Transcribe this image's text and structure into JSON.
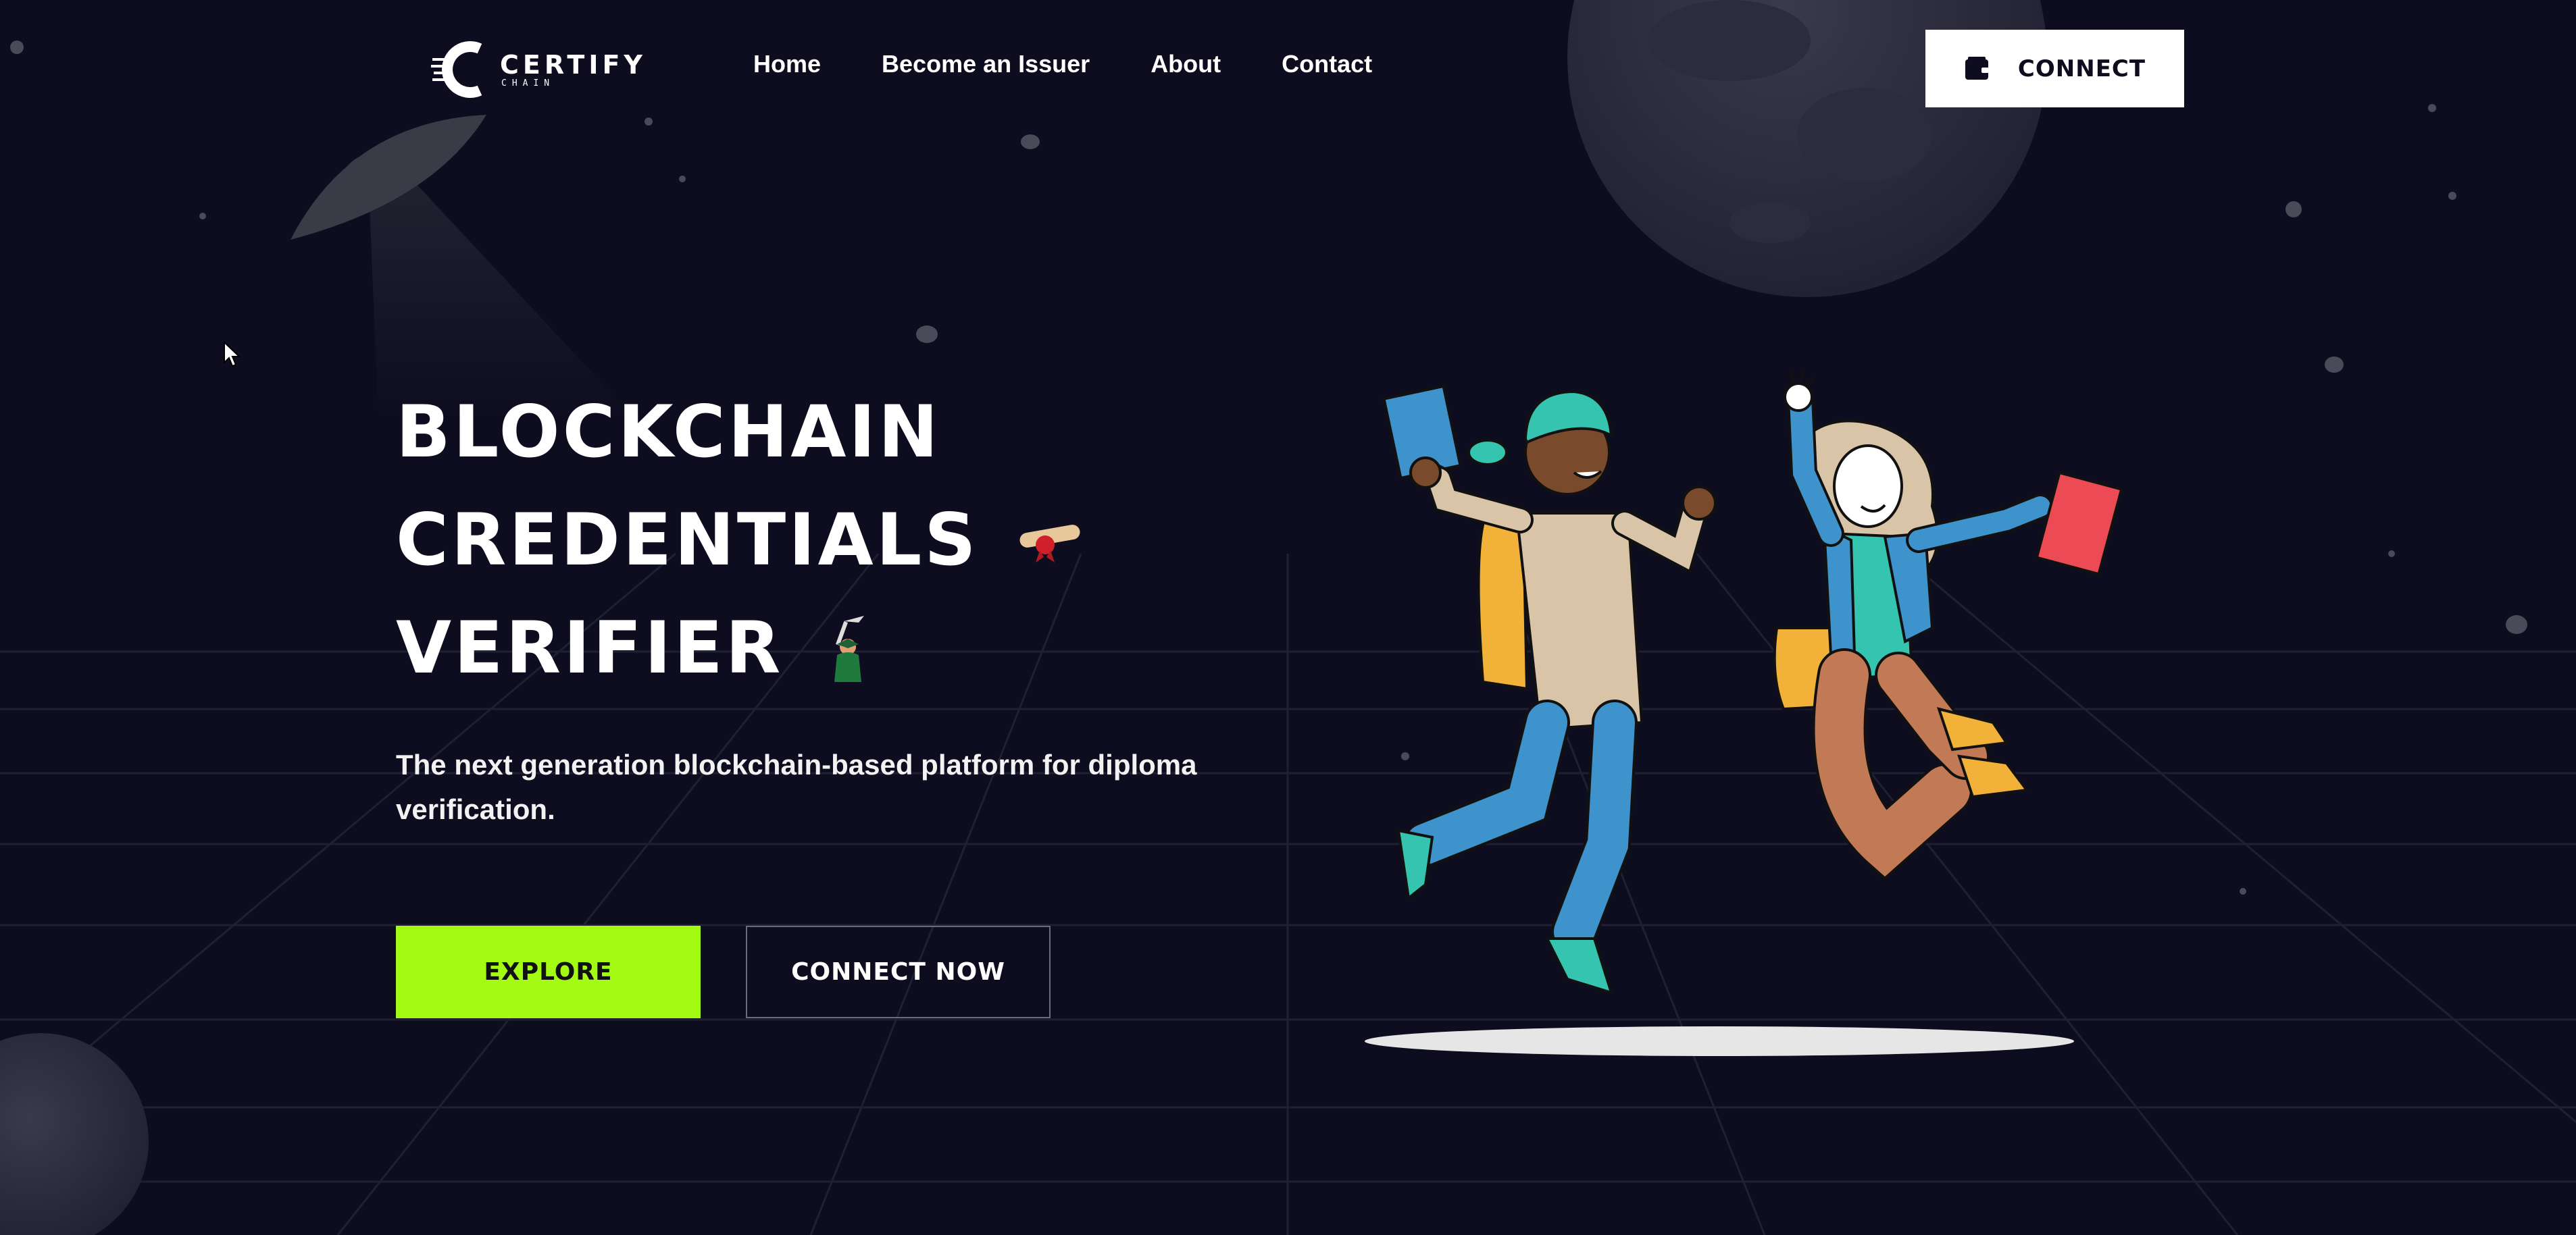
{
  "brand": {
    "name": "CERTIFY",
    "sub": "CHAIN",
    "logo_icon": "certify-c-logo"
  },
  "nav": {
    "items": [
      {
        "label": "Home"
      },
      {
        "label": "Become an Issuer"
      },
      {
        "label": "About"
      },
      {
        "label": "Contact"
      }
    ]
  },
  "header": {
    "connect_label": "CONNECT",
    "connect_icon": "wallet-icon"
  },
  "hero": {
    "title_lines": [
      "BLOCKCHAIN",
      "CREDENTIALS",
      "VERIFIER"
    ],
    "title_emojis": [
      "diploma-scroll-icon",
      "graduate-icon"
    ],
    "subtitle": "The next generation blockchain-based platform for diploma verification.",
    "explore_label": "EXPLORE",
    "connect_now_label": "CONNECT NOW"
  },
  "colors": {
    "background": "#0d0d1f",
    "accent": "#a3fb14",
    "text": "#ffffff"
  }
}
